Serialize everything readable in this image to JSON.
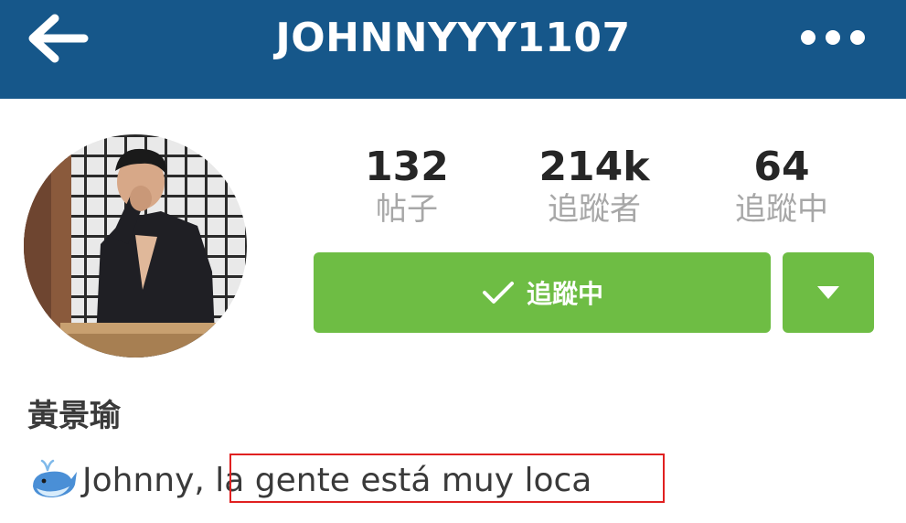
{
  "header": {
    "username": "JOHNNYYY1107",
    "back_icon": "arrow-left-icon",
    "more_icon": "more-dots-icon",
    "bar_color": "#16578a"
  },
  "profile": {
    "avatar_icon": "profile-photo",
    "stats": {
      "posts": {
        "value": "132",
        "label": "帖子"
      },
      "followers": {
        "value": "214k",
        "label": "追蹤者"
      },
      "following": {
        "value": "64",
        "label": "追蹤中"
      }
    },
    "follow_button": {
      "label": "追蹤中",
      "icon": "checkmark-icon",
      "color": "#6ebd44"
    },
    "dropdown_icon": "triangle-down-icon",
    "display_name": "黃景瑜",
    "bio": {
      "emoji_icon": "whale-emoji-icon",
      "prefix": "Johnny,",
      "highlighted": " la gente está muy loca",
      "highlight_color": "#e02020"
    }
  }
}
